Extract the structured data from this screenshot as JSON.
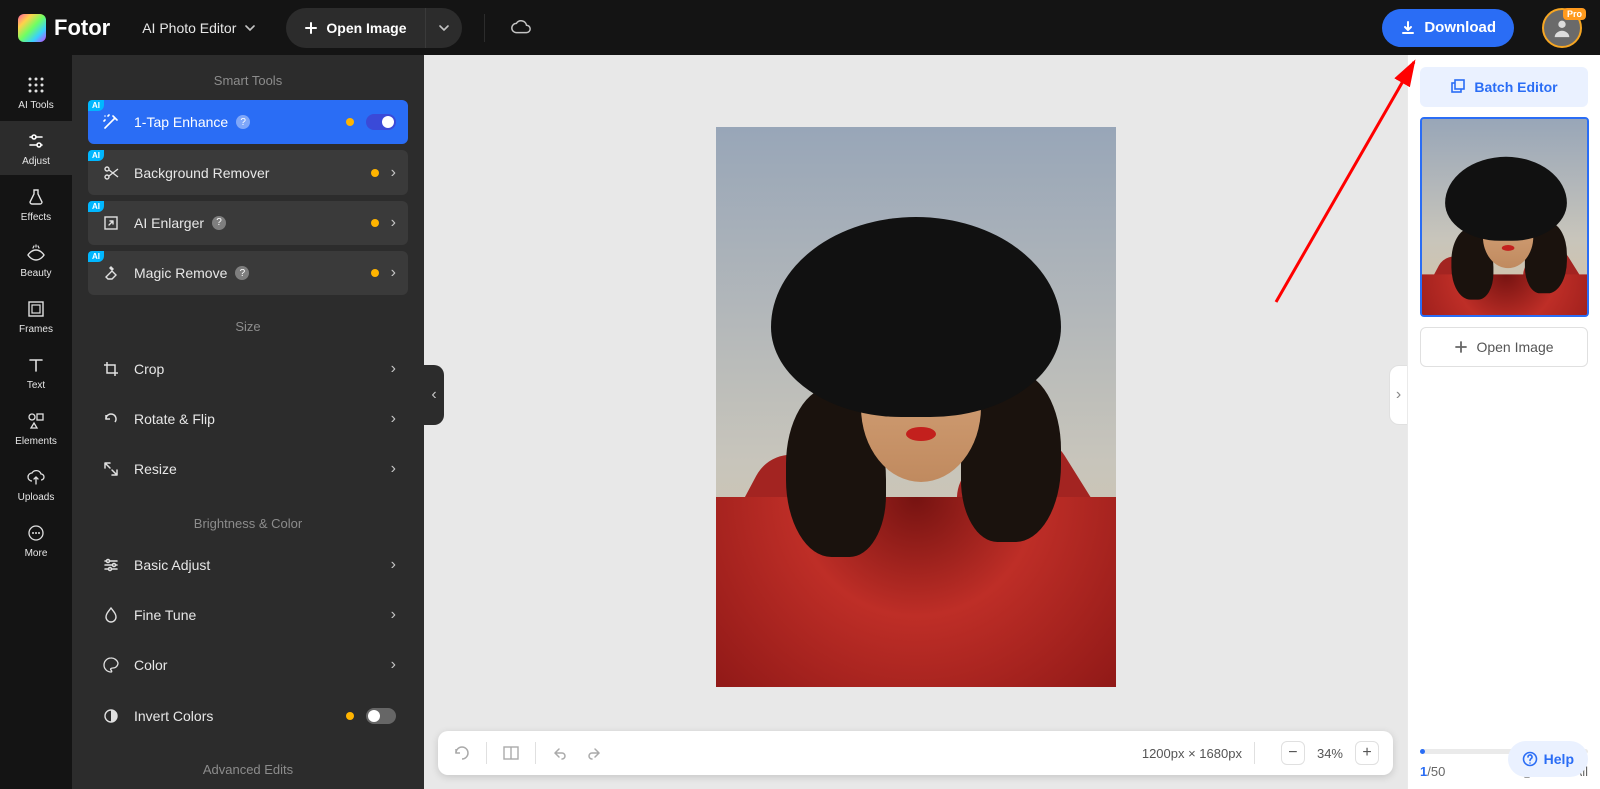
{
  "brand": {
    "name": "Fotor"
  },
  "header": {
    "mode_label": "AI Photo Editor",
    "open_image": "Open Image",
    "download": "Download",
    "avatar_badge": "Pro"
  },
  "rail": {
    "items": [
      {
        "id": "ai-tools",
        "label": "AI Tools"
      },
      {
        "id": "adjust",
        "label": "Adjust"
      },
      {
        "id": "effects",
        "label": "Effects"
      },
      {
        "id": "beauty",
        "label": "Beauty"
      },
      {
        "id": "frames",
        "label": "Frames"
      },
      {
        "id": "text",
        "label": "Text"
      },
      {
        "id": "elements",
        "label": "Elements"
      },
      {
        "id": "uploads",
        "label": "Uploads"
      },
      {
        "id": "more",
        "label": "More"
      }
    ],
    "active": "adjust"
  },
  "tools": {
    "sections": {
      "smart": "Smart Tools",
      "size": "Size",
      "brightness": "Brightness & Color",
      "advanced": "Advanced Edits"
    },
    "smart": [
      {
        "id": "enhance",
        "label": "1-Tap Enhance",
        "ai": true,
        "help": true,
        "dot": true,
        "toggle": "on",
        "active": true
      },
      {
        "id": "bgremove",
        "label": "Background Remover",
        "ai": true,
        "help": false,
        "dot": true,
        "chev": true
      },
      {
        "id": "enlarger",
        "label": "AI Enlarger",
        "ai": true,
        "help": true,
        "dot": true,
        "chev": true
      },
      {
        "id": "magicremove",
        "label": "Magic Remove",
        "ai": true,
        "help": true,
        "dot": true,
        "chev": true
      }
    ],
    "size": [
      {
        "id": "crop",
        "label": "Crop",
        "chev": true
      },
      {
        "id": "rotate",
        "label": "Rotate & Flip",
        "chev": true
      },
      {
        "id": "resize",
        "label": "Resize",
        "chev": true
      }
    ],
    "brightness": [
      {
        "id": "basicadjust",
        "label": "Basic Adjust",
        "chev": true
      },
      {
        "id": "finetune",
        "label": "Fine Tune",
        "chev": true
      },
      {
        "id": "color",
        "label": "Color",
        "chev": true
      },
      {
        "id": "invert",
        "label": "Invert Colors",
        "dot": true,
        "toggle": "off"
      }
    ]
  },
  "canvas": {
    "dimensions": "1200px × 1680px",
    "zoom": "34%"
  },
  "right": {
    "batch": "Batch Editor",
    "open_image": "Open Image",
    "count_current": "1",
    "count_sep": "/",
    "count_total": "50",
    "clear": "Clear All",
    "help": "Help"
  },
  "colors": {
    "accent": "#2a6df5",
    "warn": "#ffb400"
  }
}
